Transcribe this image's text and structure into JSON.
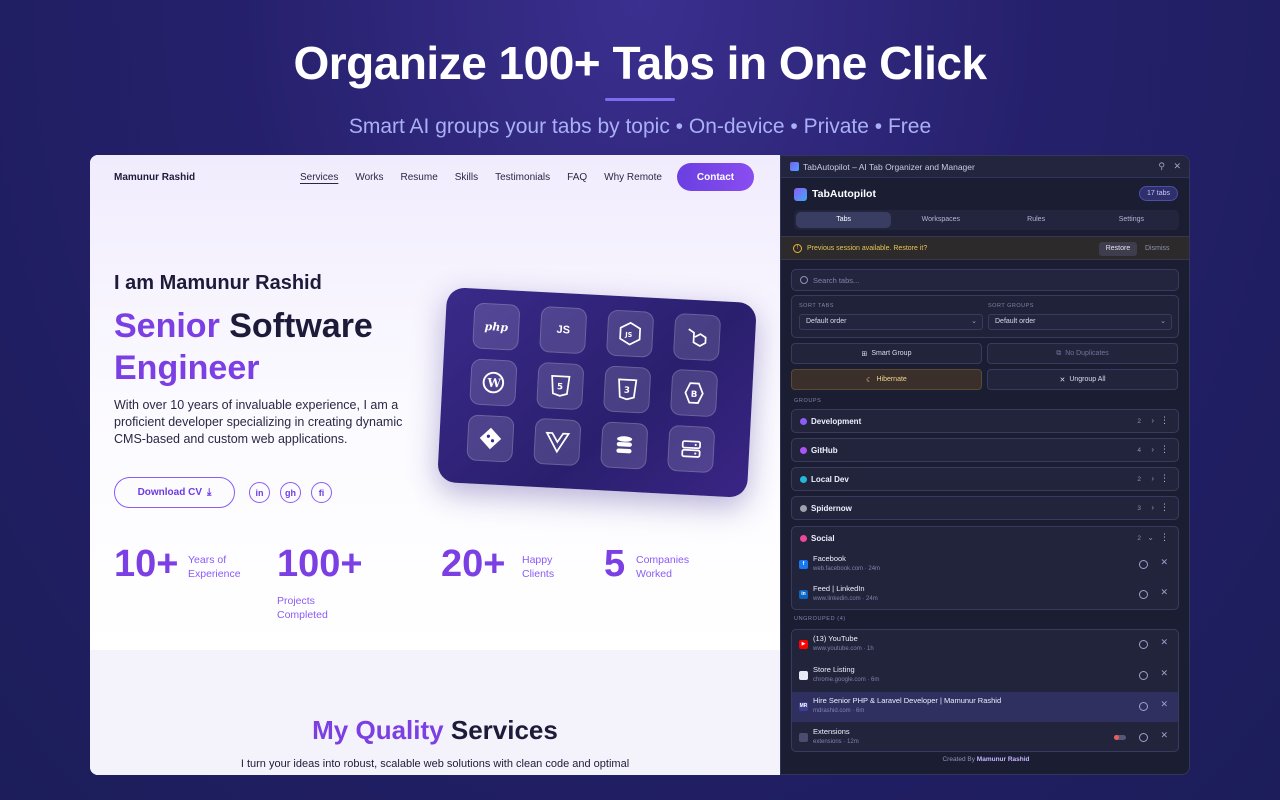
{
  "hero": {
    "title": "Organize 100+ Tabs in One Click",
    "subtitle": "Smart AI groups your tabs by topic • On-device • Private • Free"
  },
  "site": {
    "brand": "Mamunur Rashid",
    "nav": [
      "Services",
      "Works",
      "Resume",
      "Skills",
      "Testimonials",
      "FAQ",
      "Why Remote"
    ],
    "contact_label": "Contact",
    "intro": "I am Mamunur Rashid",
    "role_line1_a": "Senior",
    "role_line1_b": " Software",
    "role_line2": "Engineer",
    "bio": "With over 10 years of invaluable experience, I am a proficient developer specializing in creating dynamic CMS-based and custom web applications.",
    "cv_label": "Download CV",
    "socials": [
      "in",
      "gh",
      "fi"
    ],
    "stats": [
      {
        "num": "10+",
        "label": "Years of Experience"
      },
      {
        "num": "100+",
        "label": "Projects Completed"
      },
      {
        "num": "20+",
        "label": "Happy Clients"
      },
      {
        "num": "5",
        "label": "Companies Worked"
      }
    ],
    "tech_icons": [
      "php",
      "JS",
      "node-js",
      "laravel",
      "wordpress",
      "html5",
      "css3",
      "bootstrap",
      "git",
      "vue",
      "database",
      "server"
    ],
    "services_title_a": "My Quality",
    "services_title_b": " Services",
    "services_text": "I turn your ideas into robust, scalable web solutions with clean code and optimal"
  },
  "ext": {
    "window_title": "TabAutopilot – AI Tab Organizer and Manager",
    "app_name": "TabAutopilot",
    "tab_count": "17 tabs",
    "tabs": [
      "Tabs",
      "Workspaces",
      "Rules",
      "Settings"
    ],
    "notice": "Previous session available. Restore it?",
    "restore": "Restore",
    "dismiss": "Dismiss",
    "search_placeholder": "Search tabs...",
    "sort_tabs_label": "SORT TABS",
    "sort_groups_label": "SORT GROUPS",
    "sort_tabs_value": "Default order",
    "sort_groups_value": "Default order",
    "buttons": {
      "smart_group": "Smart Group",
      "no_duplicates": "No Duplicates",
      "hibernate": "Hibernate",
      "ungroup_all": "Ungroup All"
    },
    "groups_label": "GROUPS",
    "groups": [
      {
        "name": "Development",
        "count": "2",
        "color": "#8b5cf6"
      },
      {
        "name": "GitHub",
        "count": "4",
        "color": "#a855f7"
      },
      {
        "name": "Local Dev",
        "count": "2",
        "color": "#22b8d6"
      },
      {
        "name": "Spidernow",
        "count": "3",
        "color": "#9ca3af"
      },
      {
        "name": "Social",
        "count": "2",
        "color": "#ec4899"
      }
    ],
    "social_tabs": [
      {
        "title": "Facebook",
        "meta": "web.facebook.com · 24m"
      },
      {
        "title": "Feed | LinkedIn",
        "meta": "www.linkedin.com · 24m"
      }
    ],
    "ungrouped_label": "UNGROUPED (4)",
    "ungrouped_tabs": [
      {
        "title": "(13) YouTube",
        "meta": "www.youtube.com · 1h"
      },
      {
        "title": "Store Listing",
        "meta": "chrome.google.com · 6m"
      },
      {
        "title": "Hire Senior PHP & Laravel Developer | Mamunur Rashid",
        "meta": "mdrashid.com · 6m"
      },
      {
        "title": "Extensions",
        "meta": "extensions · 12m"
      }
    ],
    "footer_prefix": "Created By ",
    "footer_name": "Mamunur Rashid"
  }
}
